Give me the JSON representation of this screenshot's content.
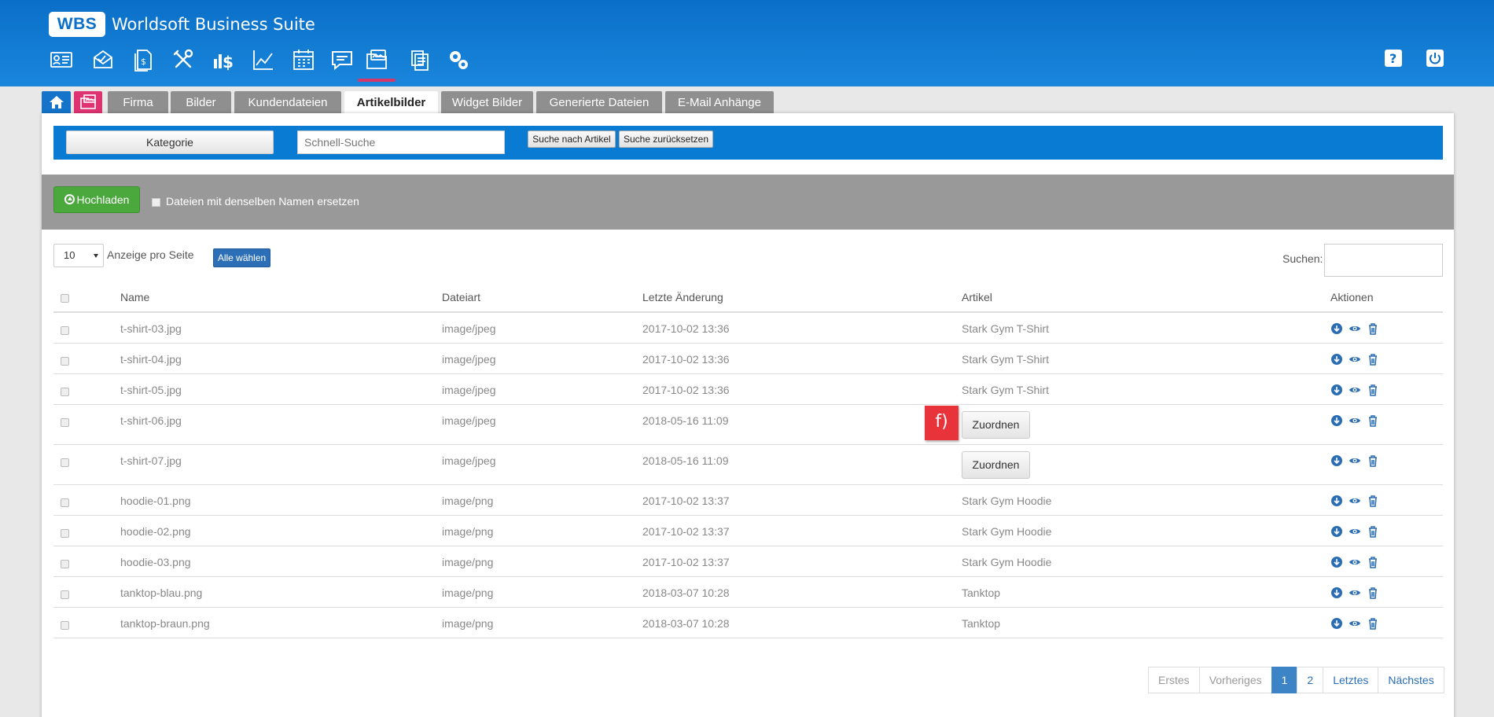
{
  "app": {
    "logo": "WBS",
    "title": "Worldsoft Business Suite"
  },
  "nav_icons": [
    "contact-card-icon",
    "mail-icon",
    "invoice-icon",
    "tools-icon",
    "finance-icon",
    "chart-icon",
    "calendar-icon",
    "chat-icon",
    "folder-image-icon",
    "documents-icon",
    "settings-icon"
  ],
  "header_buttons": {
    "help": "help-icon",
    "power": "power-icon"
  },
  "tabs": [
    "Firma",
    "Bilder",
    "Kundendateien",
    "Artikelbilder",
    "Widget Bilder",
    "Generierte Dateien",
    "E-Mail Anhänge"
  ],
  "active_tab": "Artikelbilder",
  "search": {
    "category_label": "Kategorie",
    "quick_placeholder": "Schnell-Suche",
    "search_article_label": "Suche nach Artikel",
    "reset_label": "Suche zurücksetzen"
  },
  "upload": {
    "button_label": "Hochladen",
    "replace_label": "Dateien mit denselben Namen ersetzen"
  },
  "list": {
    "per_page_value": "10",
    "per_page_label": "Anzeige pro Seite",
    "select_all_label": "Alle wählen",
    "search_label": "Suchen:"
  },
  "table": {
    "headers": {
      "name": "Name",
      "type": "Dateiart",
      "modified": "Letzte Änderung",
      "article": "Artikel",
      "actions": "Aktionen"
    },
    "rows": [
      {
        "name": "t-shirt-03.jpg",
        "type": "image/jpeg",
        "modified": "2017-10-02 13:36",
        "article": "Stark Gym T-Shirt"
      },
      {
        "name": "t-shirt-04.jpg",
        "type": "image/jpeg",
        "modified": "2017-10-02 13:36",
        "article": "Stark Gym T-Shirt"
      },
      {
        "name": "t-shirt-05.jpg",
        "type": "image/jpeg",
        "modified": "2017-10-02 13:36",
        "article": "Stark Gym T-Shirt"
      },
      {
        "name": "t-shirt-06.jpg",
        "type": "image/jpeg",
        "modified": "2018-05-16 11:09",
        "article": "",
        "assign": "Zuordnen"
      },
      {
        "name": "t-shirt-07.jpg",
        "type": "image/jpeg",
        "modified": "2018-05-16 11:09",
        "article": "",
        "assign": "Zuordnen"
      },
      {
        "name": "hoodie-01.png",
        "type": "image/png",
        "modified": "2017-10-02 13:37",
        "article": "Stark Gym Hoodie"
      },
      {
        "name": "hoodie-02.png",
        "type": "image/png",
        "modified": "2017-10-02 13:37",
        "article": "Stark Gym Hoodie"
      },
      {
        "name": "hoodie-03.png",
        "type": "image/png",
        "modified": "2017-10-02 13:37",
        "article": "Stark Gym Hoodie"
      },
      {
        "name": "tanktop-blau.png",
        "type": "image/png",
        "modified": "2018-03-07 10:28",
        "article": "Tanktop"
      },
      {
        "name": "tanktop-braun.png",
        "type": "image/png",
        "modified": "2018-03-07 10:28",
        "article": "Tanktop"
      }
    ]
  },
  "annotation": "f)",
  "pagination": {
    "first": "Erstes",
    "prev": "Vorheriges",
    "pages": [
      "1",
      "2"
    ],
    "current": "1",
    "last": "Letztes",
    "next": "Nächstes"
  },
  "colors": {
    "header_blue": "#0a6fc8",
    "accent_pink": "#df3371",
    "upload_green": "#4ba83d",
    "annotation_red": "#e9333b"
  }
}
